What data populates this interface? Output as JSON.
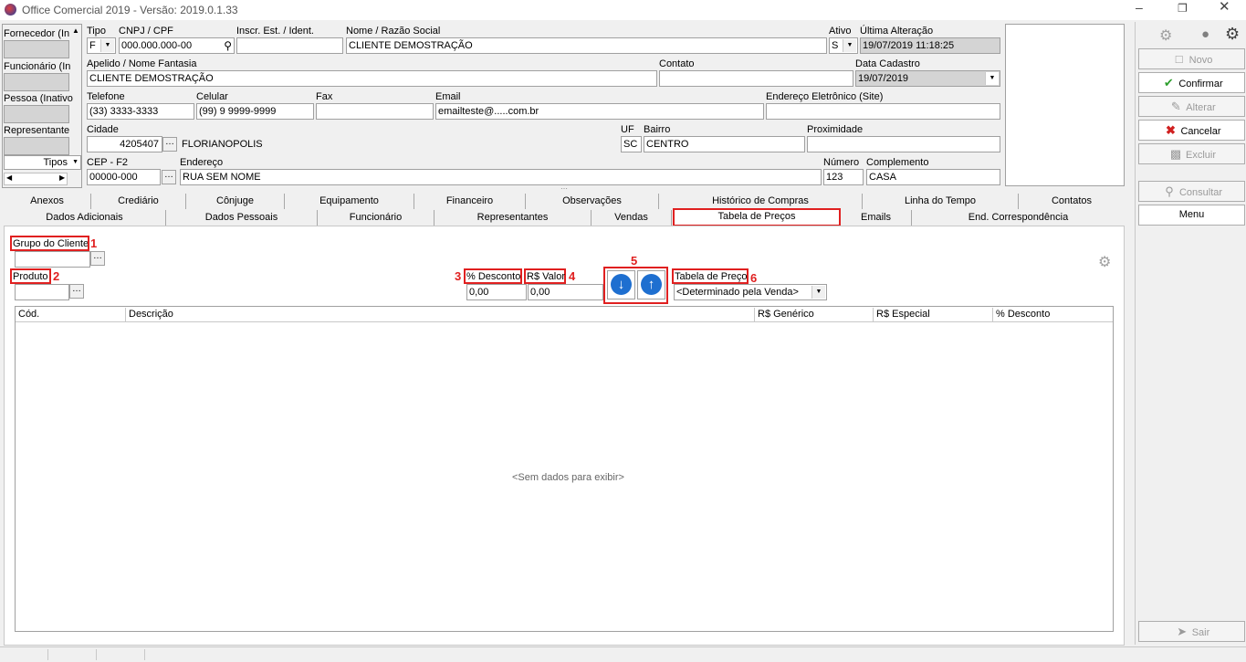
{
  "window": {
    "title": "Office Comercial 2019 - Versão: 2019.0.1.33",
    "minimize_icon": "minimize-icon",
    "restore_icon": "restore-icon",
    "close_icon": "close-icon"
  },
  "left_panel": {
    "items": [
      {
        "label": "Fornecedor (In"
      },
      {
        "label": "Funcionário (In"
      },
      {
        "label": "Pessoa (Inativo"
      },
      {
        "label": "Representante"
      }
    ],
    "tipos_label": "Tipos"
  },
  "form": {
    "tipo": {
      "label": "Tipo",
      "value": "F"
    },
    "cnpj": {
      "label": "CNPJ / CPF",
      "value": "000.000.000-00"
    },
    "inscr": {
      "label": "Inscr. Est. / Ident.",
      "value": ""
    },
    "nome": {
      "label": "Nome / Razão Social",
      "value": "CLIENTE DEMOSTRAÇÃO"
    },
    "ativo": {
      "label": "Ativo",
      "value": "S"
    },
    "ultima": {
      "label": "Última Alteração",
      "value": "19/07/2019 11:18:25"
    },
    "apelido": {
      "label": "Apelido / Nome Fantasia",
      "value": "CLIENTE DEMOSTRAÇÃO"
    },
    "contato": {
      "label": "Contato",
      "value": ""
    },
    "data_cadastro": {
      "label": "Data Cadastro",
      "value": "19/07/2019"
    },
    "telefone": {
      "label": "Telefone",
      "value": "(33) 3333-3333"
    },
    "celular": {
      "label": "Celular",
      "value": "(99) 9 9999-9999"
    },
    "fax": {
      "label": "Fax",
      "value": ""
    },
    "email": {
      "label": "Email",
      "value": "emailteste@.....com.br"
    },
    "site": {
      "label": "Endereço Eletrônico (Site)",
      "value": ""
    },
    "cidade": {
      "label": "Cidade",
      "code": "4205407",
      "name": "FLORIANOPOLIS"
    },
    "uf": {
      "label": "UF",
      "value": "SC"
    },
    "bairro": {
      "label": "Bairro",
      "value": "CENTRO"
    },
    "proximidade": {
      "label": "Proximidade",
      "value": ""
    },
    "cep": {
      "label": "CEP - F2",
      "value": "00000-000"
    },
    "endereco": {
      "label": "Endereço",
      "value": "RUA SEM NOME"
    },
    "numero": {
      "label": "Número",
      "value": "123"
    },
    "complemento": {
      "label": "Complemento",
      "value": "CASA"
    }
  },
  "tabs_row1": [
    "Anexos",
    "Crediário",
    "Cônjuge",
    "Equipamento",
    "Financeiro",
    "Observações",
    "Histórico de Compras",
    "Linha do Tempo",
    "Contatos"
  ],
  "tabs_row2": [
    "Dados Adicionais",
    "Dados Pessoais",
    "Funcionário",
    "Representantes",
    "Vendas",
    "Tabela de Preços",
    "Emails",
    "End. Correspondência"
  ],
  "price_table": {
    "grupo_label": "Grupo do Cliente",
    "produto_label": "Produto",
    "desconto_label": "% Desconto",
    "desconto_value": "0,00",
    "valor_label": "R$ Valor",
    "valor_value": "0,00",
    "tabela_label": "Tabela de Preço",
    "tabela_value": "<Determinado pela Venda>",
    "columns": [
      "Cód.",
      "Descrição",
      "R$ Genérico",
      "R$ Especial",
      "% Desconto"
    ],
    "empty_text": "<Sem dados para exibir>"
  },
  "annotations": [
    "1",
    "2",
    "3",
    "4",
    "5",
    "6"
  ],
  "side_buttons": [
    {
      "label": "Novo",
      "icon": "document-icon"
    },
    {
      "label": "Confirmar",
      "icon": "checkmark-icon"
    },
    {
      "label": "Alterar",
      "icon": "edit-icon"
    },
    {
      "label": "Cancelar",
      "icon": "x-icon"
    },
    {
      "label": "Excluir",
      "icon": "trash-icon"
    },
    {
      "label": "Consultar",
      "icon": "magnifier-icon"
    },
    {
      "label": "Menu",
      "icon": ""
    },
    {
      "label": "Sair",
      "icon": "exit-icon"
    }
  ],
  "colors": {
    "accent_red": "#e02020",
    "arrow_blue": "#1e6fd0",
    "confirm_green": "#2e9e2e",
    "cancel_red": "#d02020"
  }
}
